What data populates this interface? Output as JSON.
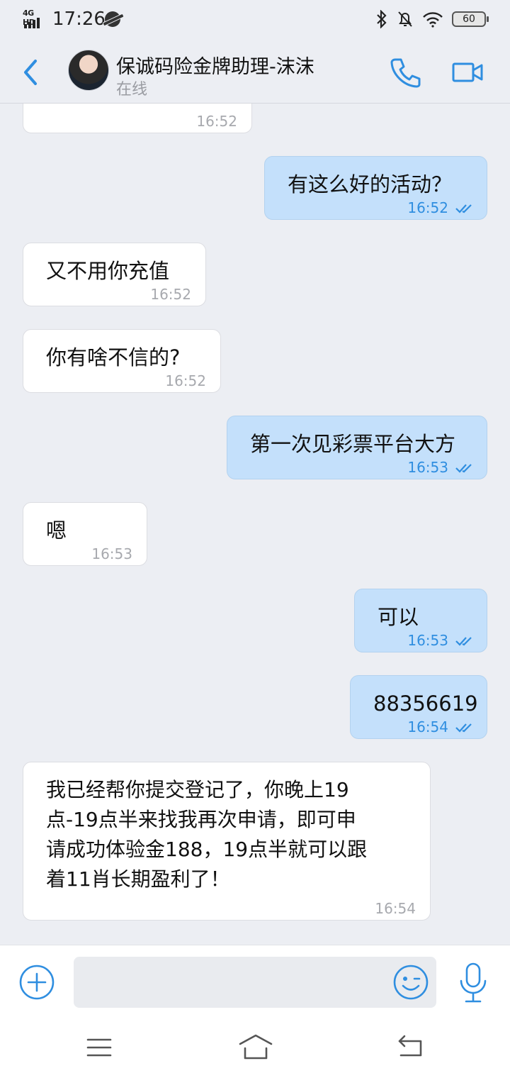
{
  "status_bar": {
    "network": "4G HD",
    "time": "17:26",
    "battery": "60"
  },
  "header": {
    "contact_name": "保诚码险金牌助理-沫沫",
    "contact_status": "在线"
  },
  "messages": [
    {
      "direction": "in",
      "text": "",
      "time": "16:52"
    },
    {
      "direction": "out",
      "text": "有这么好的活动？",
      "time": "16:52",
      "read": true
    },
    {
      "direction": "in",
      "text": "又不用你充值",
      "time": "16:52"
    },
    {
      "direction": "in",
      "text": "你有啥不信的?",
      "time": "16:52"
    },
    {
      "direction": "out",
      "text": "第一次见彩票平台大方",
      "time": "16:53",
      "read": true
    },
    {
      "direction": "in",
      "text": "嗯",
      "time": "16:53"
    },
    {
      "direction": "out",
      "text": "可以",
      "time": "16:53",
      "read": true
    },
    {
      "direction": "out",
      "text": "88356619",
      "time": "16:54",
      "read": true
    },
    {
      "direction": "in",
      "text_lines": [
        "我已经帮你提交登记了，你晚上19",
        "点-19点半来找我再次申请，即可申",
        "请成功体验金188，19点半就可以跟",
        "着11肖长期盈利了！"
      ],
      "time": "16:54"
    }
  ],
  "input": {
    "placeholder": ""
  },
  "icons": {
    "back": "chevron-left-icon",
    "call": "phone-icon",
    "video": "video-camera-icon",
    "plus": "plus-circle-icon",
    "emoji": "smiley-icon",
    "mic": "microphone-icon",
    "nav_menu": "menu-icon",
    "nav_home": "home-icon",
    "nav_back": "back-arrow-icon"
  },
  "colors": {
    "accent": "#2f8ee0",
    "outgoing_bubble": "#c4e0fb",
    "incoming_bubble": "#ffffff",
    "background": "#eceef3"
  }
}
